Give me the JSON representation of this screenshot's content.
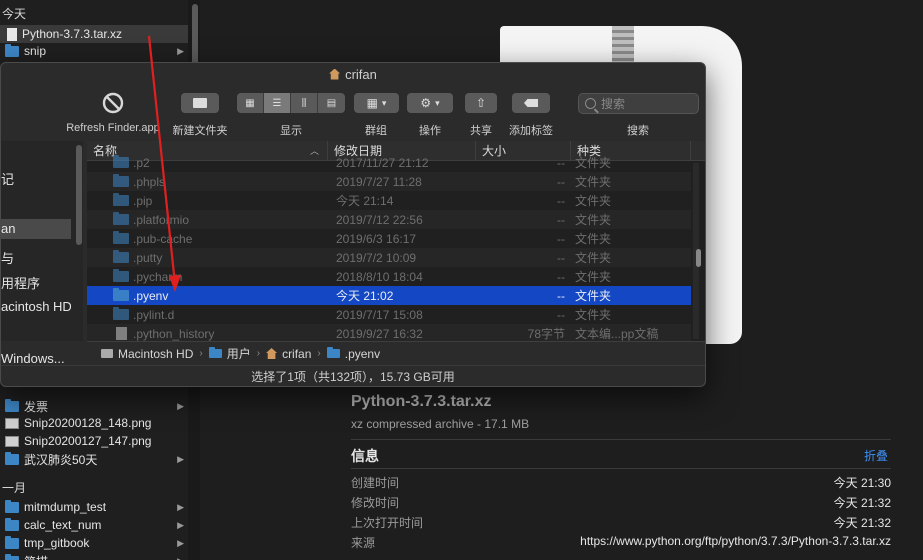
{
  "background_finder": {
    "section_today": "今天",
    "section_jan": "一月",
    "items_top": [
      {
        "name": "Python-3.7.3.tar.xz",
        "icon": "file-icon",
        "has_chevron": false
      },
      {
        "name": "snip",
        "icon": "folder-icon",
        "has_chevron": true
      }
    ],
    "items_bottom": [
      {
        "name": "发票",
        "icon": "folder-icon",
        "has_chevron": true
      },
      {
        "name": "Snip20200128_148.png",
        "icon": "image-icon",
        "has_chevron": false
      },
      {
        "name": "Snip20200127_147.png",
        "icon": "image-icon",
        "has_chevron": false
      },
      {
        "name": "武汉肺炎50天",
        "icon": "folder-icon",
        "has_chevron": true
      }
    ],
    "items_jan": [
      {
        "name": "mitmdump_test",
        "icon": "folder-icon",
        "has_chevron": true
      },
      {
        "name": "calc_text_num",
        "icon": "folder-icon",
        "has_chevron": true
      },
      {
        "name": "tmp_gitbook",
        "icon": "folder-icon",
        "has_chevron": true
      },
      {
        "name": "简描",
        "icon": "folder-icon",
        "has_chevron": true
      }
    ]
  },
  "dialog": {
    "title": "crifan",
    "toolbar": {
      "refresh_label": "Refresh Finder.app",
      "new_folder_label": "新建文件夹",
      "view_label": "显示",
      "group_label": "群组",
      "action_label": "操作",
      "share_label": "共享",
      "tag_label": "添加标签",
      "search_label": "搜索",
      "search_placeholder": "搜索"
    },
    "sidebar_items": [
      "记",
      "an",
      "与",
      "用程序",
      "acintosh HD",
      "Windows..."
    ],
    "columns": {
      "name": "名称",
      "date": "修改日期",
      "size": "大小",
      "kind": "种类"
    },
    "rows": [
      {
        "name": ".p2",
        "date": "2017/11/27 21:12",
        "size": "--",
        "kind": "文件夹",
        "icon": "folder-icon"
      },
      {
        "name": ".phpls",
        "date": "2019/7/27 11:28",
        "size": "--",
        "kind": "文件夹",
        "icon": "folder-icon"
      },
      {
        "name": ".pip",
        "date": "今天 21:14",
        "size": "--",
        "kind": "文件夹",
        "icon": "folder-icon"
      },
      {
        "name": ".platformio",
        "date": "2019/7/12 22:56",
        "size": "--",
        "kind": "文件夹",
        "icon": "folder-icon"
      },
      {
        "name": ".pub-cache",
        "date": "2019/6/3 16:17",
        "size": "--",
        "kind": "文件夹",
        "icon": "folder-icon"
      },
      {
        "name": ".putty",
        "date": "2019/7/2 10:09",
        "size": "--",
        "kind": "文件夹",
        "icon": "folder-icon"
      },
      {
        "name": ".pycharm",
        "date": "2018/8/10 18:04",
        "size": "--",
        "kind": "文件夹",
        "icon": "folder-icon"
      },
      {
        "name": ".pyenv",
        "date": "今天 21:02",
        "size": "--",
        "kind": "文件夹",
        "icon": "folder-icon",
        "selected": true
      },
      {
        "name": ".pylint.d",
        "date": "2019/7/17 15:08",
        "size": "--",
        "kind": "文件夹",
        "icon": "folder-icon"
      },
      {
        "name": ".python_history",
        "date": "2019/9/27 16:32",
        "size": "78字节",
        "kind": "文本编...pp文稿",
        "icon": "document-icon"
      }
    ],
    "path": [
      "Macintosh HD",
      "用户",
      "crifan",
      ".pyenv"
    ],
    "status": "选择了1项（共132项），15.73 GB可用"
  },
  "preview": {
    "filename": "Python-3.7.3.tar.xz",
    "subtitle": "xz compressed archive - 17.1 MB",
    "info_heading": "信息",
    "collapse_label": "折叠",
    "info_rows": [
      {
        "key": "创建时间",
        "value": "今天 21:30"
      },
      {
        "key": "修改时间",
        "value": "今天 21:32"
      },
      {
        "key": "上次打开时间",
        "value": "今天 21:32"
      },
      {
        "key": "来源",
        "value": "https://www.python.org/ftp/python/3.7.3/Python-3.7.3.tar.xz"
      }
    ]
  },
  "annotation_color": "#e02020",
  "accent_color": "#1447c4"
}
